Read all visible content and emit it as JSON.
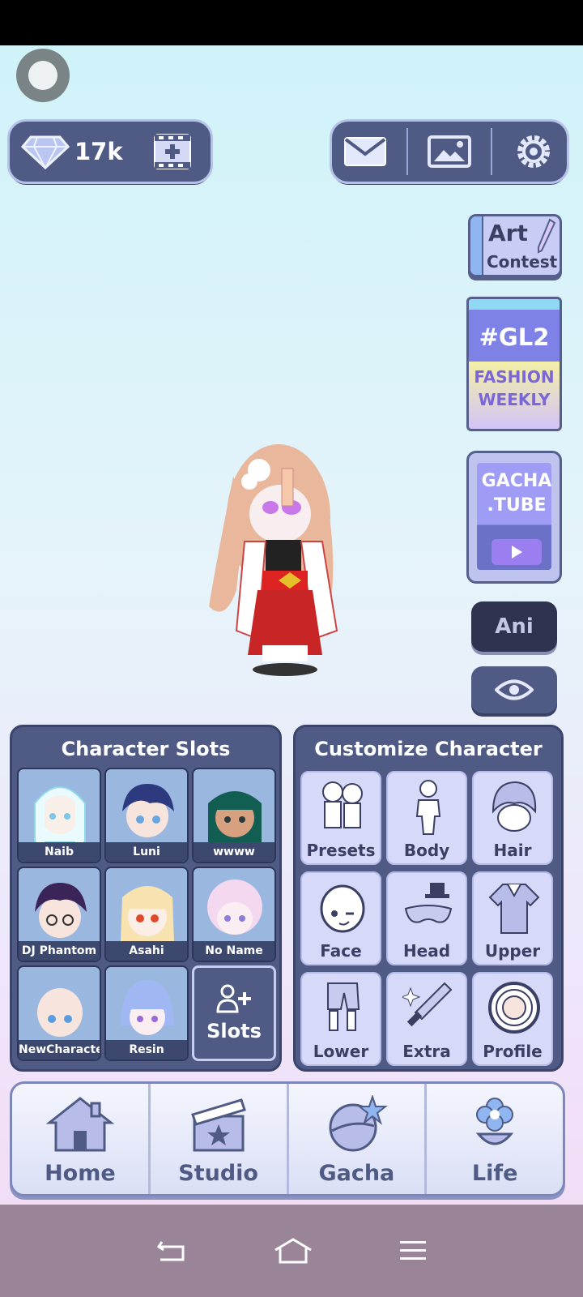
{
  "hud": {
    "gems": "17k"
  },
  "side": {
    "art_contest_line1": "Art",
    "art_contest_line2": "Contest",
    "gl2_hash": "#GL2",
    "gl2_line1": "FASHION",
    "gl2_line2": "WEEKLY",
    "gacha_tube_line1": "GACHA",
    "gacha_tube_line2": ".TUBE",
    "ani": "Ani"
  },
  "slots": {
    "title": "Character Slots",
    "items": [
      {
        "name": "Naib"
      },
      {
        "name": "Luni"
      },
      {
        "name": "wwww"
      },
      {
        "name": "DJ Phantom"
      },
      {
        "name": "Asahi"
      },
      {
        "name": "No Name"
      },
      {
        "name": "NewCharacter"
      },
      {
        "name": "Resin"
      }
    ],
    "add_label": "Slots"
  },
  "customize": {
    "title": "Customize Character",
    "items": [
      {
        "label": "Presets"
      },
      {
        "label": "Body"
      },
      {
        "label": "Hair"
      },
      {
        "label": "Face"
      },
      {
        "label": "Head"
      },
      {
        "label": "Upper"
      },
      {
        "label": "Lower"
      },
      {
        "label": "Extra"
      },
      {
        "label": "Profile"
      }
    ]
  },
  "nav": {
    "items": [
      {
        "label": "Home"
      },
      {
        "label": "Studio"
      },
      {
        "label": "Gacha"
      },
      {
        "label": "Life"
      }
    ]
  }
}
